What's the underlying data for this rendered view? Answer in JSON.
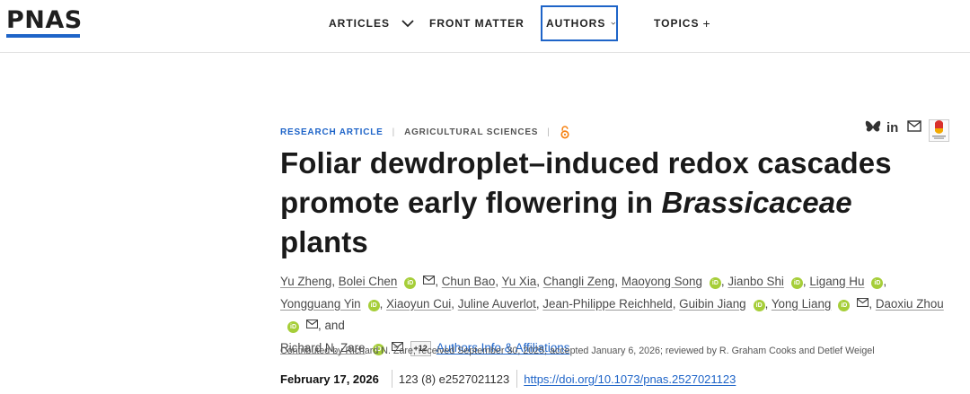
{
  "header": {
    "logo": "PNAS",
    "nav": [
      {
        "label": "ARTICLES",
        "chevron": true
      },
      {
        "label": "FRONT MATTER",
        "chevron": false
      },
      {
        "label": "AUTHORS",
        "chevron": true
      },
      {
        "label": "TOPICS",
        "suffix": "+"
      }
    ]
  },
  "article": {
    "type": "RESEARCH ARTICLE",
    "subject": "AGRICULTURAL SCIENCES",
    "title_line1": "Foliar dewdroplet–induced redox cascades",
    "title_line2_a": "promote early flowering in ",
    "title_line2_b": "Brassicaceae",
    "title_line3": "plants",
    "authors": [
      "Yu Zheng",
      "Bolei Chen",
      "Chun Bao",
      "Yu Xia",
      "Changli Zeng",
      "Maoyong Song",
      "Jianbo Shi",
      "Ligang Hu",
      "Yongguang Yin",
      "Xiaoyun Cui",
      "Juline Auverlot",
      "Jean-Philippe Reichheld",
      "Guibin Jiang",
      "Yong Liang",
      "Daoxiu Zhou",
      "Richard N. Zare"
    ],
    "and_word": "and",
    "more_count": "+12",
    "affiliations_link": "Authors Info & Affiliations",
    "contributed": "Contributed by Richard N. Zare; received September 30, 2025; accepted January 6, 2026; reviewed by R. Graham Cooks and Detlef Weigel",
    "date": "February 17, 2026",
    "citation": "123 (8) e2527021123",
    "doi": "https://doi.org/10.1073/pnas.2527021123"
  },
  "icons": [
    "bluesky-icon",
    "linkedin-icon",
    "mail-icon",
    "crossmark-icon",
    "orcid-icon",
    "open-access-icon"
  ],
  "colors": {
    "accent": "#1e64c8",
    "orcid": "#a6ce39",
    "open_access": "#f68212"
  }
}
